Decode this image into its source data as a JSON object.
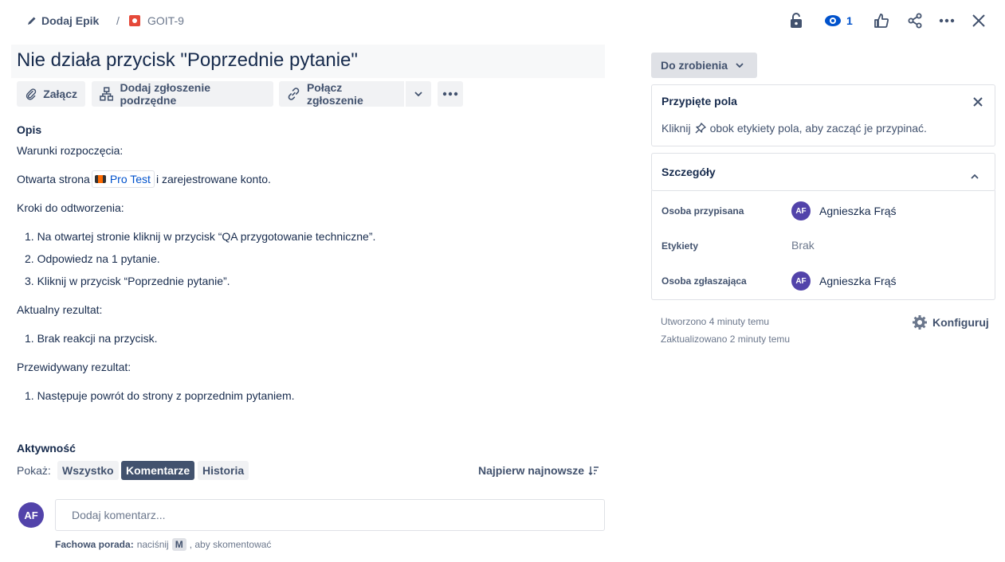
{
  "breadcrumb": {
    "epic_label": "Dodaj Epik",
    "separator": "/",
    "issue_key": "GOIT-9"
  },
  "header_actions": {
    "watch_count": "1"
  },
  "issue": {
    "title": "Nie działa przycisk \"Poprzednie pytanie\""
  },
  "toolbar": {
    "attach_label": "Załącz",
    "add_child_label": "Dodaj zgłoszenie podrzędne",
    "link_issue_label": "Połącz zgłoszenie"
  },
  "description": {
    "heading": "Opis",
    "preconditions_heading": "Warunki rozpoczęcia:",
    "preconditions_before": "Otwarta strona",
    "preconditions_link": "Pro Test",
    "preconditions_after": "i zarejestrowane konto.",
    "steps_heading": "Kroki do odtworzenia:",
    "steps": [
      "1. Na otwartej stronie kliknij w przycisk “QA przygotowanie techniczne”.",
      "2. Odpowiedz na 1 pytanie.",
      "3. Kliknij w przycisk “Poprzednie pytanie”."
    ],
    "actual_heading": "Aktualny rezultat:",
    "actual": [
      "1. Brak reakcji na przycisk."
    ],
    "expected_heading": "Przewidywany rezultat:",
    "expected": [
      "1. Następuje powrót do strony z poprzednim pytaniem."
    ]
  },
  "activity": {
    "heading": "Aktywność",
    "show_label": "Pokaż:",
    "filters": [
      "Wszystko",
      "Komentarze",
      "Historia"
    ],
    "active_filter": "Komentarze",
    "sort_label": "Najpierw najnowsze",
    "avatar_initials": "AF",
    "comment_placeholder": "Dodaj komentarz...",
    "tip_bold": "Fachowa porada:",
    "tip_before": "naciśnij",
    "tip_key": "M",
    "tip_after": ", aby skomentować"
  },
  "sidebar": {
    "status": "Do zrobienia",
    "pinned": {
      "title": "Przypięte pola",
      "hint_before": "Kliknij",
      "hint_after": "obok etykiety pola, aby zacząć je przypinać."
    },
    "details": {
      "title": "Szczegóły",
      "assignee_label": "Osoba przypisana",
      "assignee_initials": "AF",
      "assignee_name": "Agnieszka Frąś",
      "labels_label": "Etykiety",
      "labels_value": "Brak",
      "reporter_label": "Osoba zgłaszająca",
      "reporter_initials": "AF",
      "reporter_name": "Agnieszka Frąś"
    },
    "created": "Utworzono 4 minuty temu",
    "updated": "Zaktualizowano 2 minuty temu",
    "configure_label": "Konfiguruj"
  },
  "colors": {
    "avatar": "#5243aa",
    "bug": "#e5493a",
    "link": "#0052cc",
    "active_filter": "#42526e"
  }
}
